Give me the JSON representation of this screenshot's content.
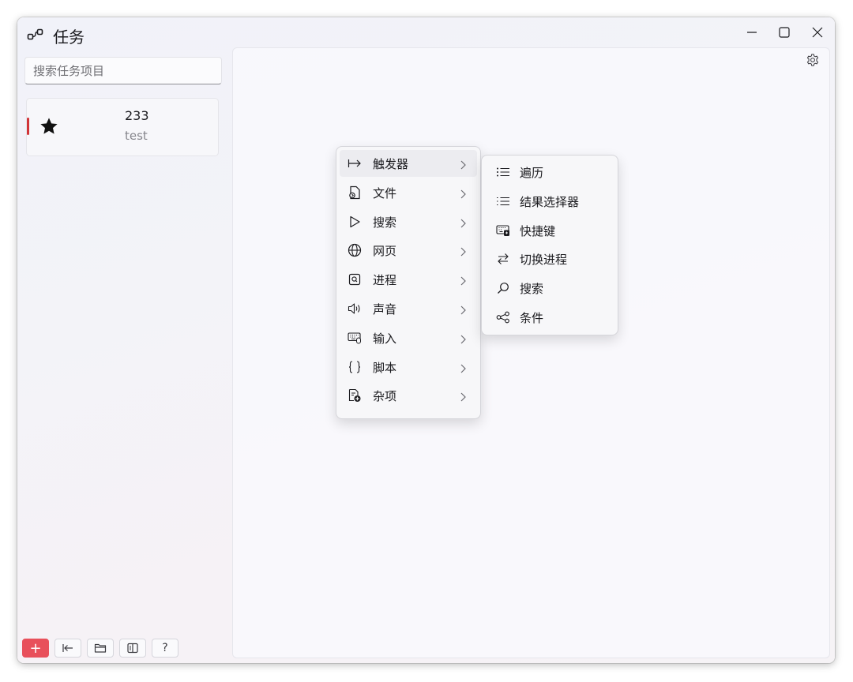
{
  "window": {
    "title": "任务",
    "icon": "flow-nodes-icon",
    "controls": [
      "minimize-icon",
      "maximize-icon",
      "close-icon"
    ]
  },
  "sidebar": {
    "search": {
      "placeholder": "搜索任务项目",
      "value": ""
    },
    "tasks": [
      {
        "name": "233",
        "description": "test",
        "icon": "star-icon",
        "accent_color": "#d13438"
      }
    ],
    "bottom_buttons": [
      {
        "icon": "plus-icon",
        "label": "+",
        "color": "#e8505b"
      },
      {
        "icon": "collapse-left-icon"
      },
      {
        "icon": "folder-icon"
      },
      {
        "icon": "book-icon"
      },
      {
        "icon": "help-icon",
        "label": "?"
      }
    ]
  },
  "content": {
    "settings_icon": "gear-icon"
  },
  "context_menu": {
    "items": [
      {
        "label": "触发器",
        "icon": "arrow-right-bar-icon",
        "has_submenu": true,
        "active": true
      },
      {
        "label": "文件",
        "icon": "file-icon",
        "has_submenu": true
      },
      {
        "label": "搜索",
        "icon": "play-icon",
        "has_submenu": true
      },
      {
        "label": "网页",
        "icon": "globe-icon",
        "has_submenu": true
      },
      {
        "label": "进程",
        "icon": "process-icon",
        "has_submenu": true
      },
      {
        "label": "声音",
        "icon": "speaker-icon",
        "has_submenu": true
      },
      {
        "label": "输入",
        "icon": "keyboard-icon",
        "has_submenu": true
      },
      {
        "label": "脚本",
        "icon": "braces-icon",
        "has_submenu": true
      },
      {
        "label": "杂项",
        "icon": "misc-add-icon",
        "has_submenu": true
      }
    ],
    "submenu": {
      "items": [
        {
          "label": "遍历",
          "icon": "list-icon"
        },
        {
          "label": "结果选择器",
          "icon": "list-select-icon"
        },
        {
          "label": "快捷键",
          "icon": "keyboard-shortcut-icon"
        },
        {
          "label": "切换进程",
          "icon": "swap-icon"
        },
        {
          "label": "搜索",
          "icon": "search-icon"
        },
        {
          "label": "条件",
          "icon": "branch-icon"
        }
      ]
    }
  }
}
